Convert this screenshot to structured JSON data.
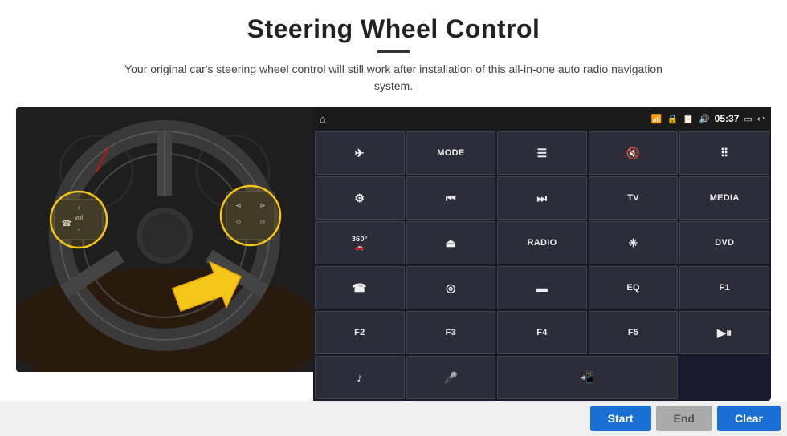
{
  "header": {
    "title": "Steering Wheel Control",
    "subtitle": "Your original car's steering wheel control will still work after installation of this all-in-one auto radio navigation system."
  },
  "statusBar": {
    "time": "05:37",
    "icons": [
      "home",
      "wifi",
      "lock",
      "sim",
      "bluetooth",
      "screen",
      "back"
    ]
  },
  "buttonGrid": [
    {
      "id": "navigate",
      "label": "✈",
      "type": "icon"
    },
    {
      "id": "mode",
      "label": "MODE",
      "type": "text"
    },
    {
      "id": "menu",
      "label": "≡",
      "type": "icon"
    },
    {
      "id": "mute",
      "label": "🔇",
      "type": "icon"
    },
    {
      "id": "apps",
      "label": "⊞",
      "type": "icon"
    },
    {
      "id": "settings",
      "label": "⚙",
      "type": "icon"
    },
    {
      "id": "rewind",
      "label": "⏮",
      "type": "icon"
    },
    {
      "id": "forward",
      "label": "⏭",
      "type": "icon"
    },
    {
      "id": "tv",
      "label": "TV",
      "type": "text"
    },
    {
      "id": "media",
      "label": "MEDIA",
      "type": "text"
    },
    {
      "id": "camera360",
      "label": "360°",
      "type": "text"
    },
    {
      "id": "eject",
      "label": "⏏",
      "type": "icon"
    },
    {
      "id": "radio",
      "label": "RADIO",
      "type": "text"
    },
    {
      "id": "brightness",
      "label": "☀",
      "type": "icon"
    },
    {
      "id": "dvd",
      "label": "DVD",
      "type": "text"
    },
    {
      "id": "phone",
      "label": "📞",
      "type": "icon"
    },
    {
      "id": "satellite",
      "label": "◎",
      "type": "icon"
    },
    {
      "id": "aspect",
      "label": "▬",
      "type": "icon"
    },
    {
      "id": "eq",
      "label": "EQ",
      "type": "text"
    },
    {
      "id": "f1",
      "label": "F1",
      "type": "text"
    },
    {
      "id": "f2",
      "label": "F2",
      "type": "text"
    },
    {
      "id": "f3",
      "label": "F3",
      "type": "text"
    },
    {
      "id": "f4",
      "label": "F4",
      "type": "text"
    },
    {
      "id": "f5",
      "label": "F5",
      "type": "text"
    },
    {
      "id": "playpause",
      "label": "▶⏸",
      "type": "icon"
    },
    {
      "id": "music",
      "label": "♪",
      "type": "icon"
    },
    {
      "id": "mic",
      "label": "🎤",
      "type": "icon"
    },
    {
      "id": "answer",
      "label": "📲",
      "type": "icon"
    }
  ],
  "actions": {
    "start": "Start",
    "end": "End",
    "clear": "Clear"
  }
}
